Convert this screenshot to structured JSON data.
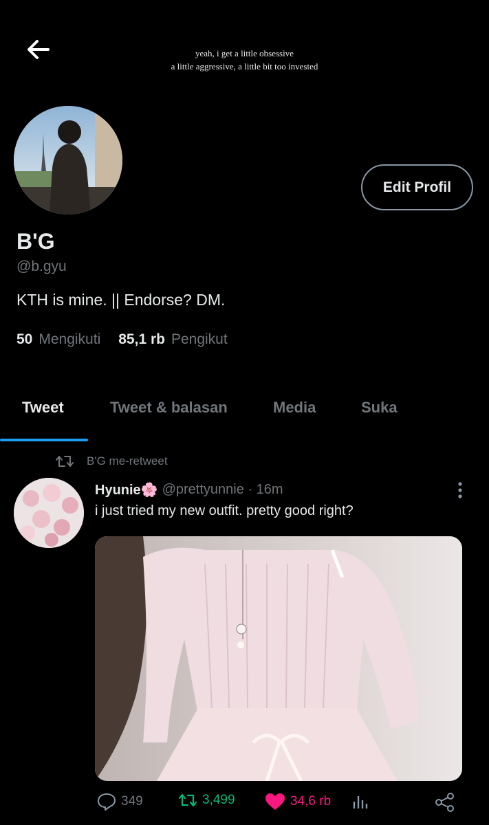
{
  "header": {
    "back_icon": "arrow-left-icon",
    "banner_line1": "yeah, i get a little obsessive",
    "banner_line2": "a little aggressive, a little bit too invested"
  },
  "profile": {
    "edit_label": "Edit Profil",
    "name": "B'G",
    "handle": "@b.gyu",
    "bio": "KTH is mine. || Endorse? DM.",
    "following_count": "50",
    "following_label": "Mengikuti",
    "followers_count": "85,1 rb",
    "followers_label": "Pengikut"
  },
  "tabs": [
    {
      "label": "Tweet",
      "active": true
    },
    {
      "label": "Tweet & balasan",
      "active": false
    },
    {
      "label": "Media",
      "active": false
    },
    {
      "label": "Suka",
      "active": false
    }
  ],
  "tweet": {
    "retweet_text": "B'G me-retweet",
    "author_name": "Hyunie🌸",
    "author_handle": "@prettyunnie",
    "time": "16m",
    "text": "i just tried my new outfit. pretty good right?",
    "replies": "349",
    "retweets": "3,499",
    "likes": "34,6 rb",
    "retweet_color": "#00ba7c",
    "like_color": "#f91880"
  },
  "colors": {
    "accent": "#1d9bf0",
    "muted": "#71767b",
    "text": "#e7e9ea"
  }
}
